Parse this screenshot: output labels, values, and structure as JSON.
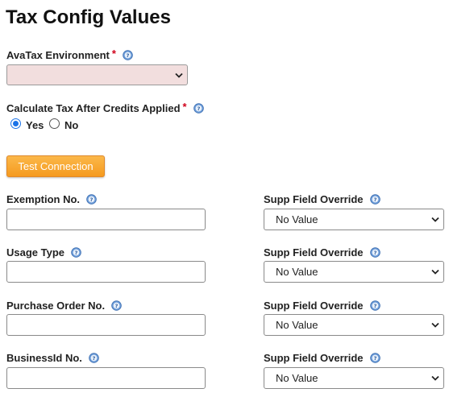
{
  "page": {
    "title": "Tax Config Values"
  },
  "avatax_environment": {
    "label": "AvaTax Environment",
    "required_mark": "*",
    "value": ""
  },
  "calculate_after_credits": {
    "label": "Calculate Tax After Credits Applied",
    "required_mark": "*",
    "options": [
      "Yes",
      "No"
    ],
    "selected": "Yes"
  },
  "test_connection": {
    "label": "Test Connection"
  },
  "fields": [
    {
      "label": "Exemption No.",
      "value": "",
      "supp_label": "Supp Field Override",
      "supp_value": "No Value"
    },
    {
      "label": "Usage Type",
      "value": "",
      "supp_label": "Supp Field Override",
      "supp_value": "No Value"
    },
    {
      "label": "Purchase Order No.",
      "value": "",
      "supp_label": "Supp Field Override",
      "supp_value": "No Value"
    },
    {
      "label": "BusinessId No.",
      "value": "",
      "supp_label": "Supp Field Override",
      "supp_value": "No Value"
    }
  ],
  "icons": {
    "help": "help-circle-icon",
    "dropdown": "chevron-down-icon"
  },
  "colors": {
    "required": "#d0021b",
    "button_orange": "#f7a32b",
    "radio_selected": "#1a73e8",
    "env_select_bg": "#f2dede",
    "help_icon_blue": "#5b8fd4"
  }
}
